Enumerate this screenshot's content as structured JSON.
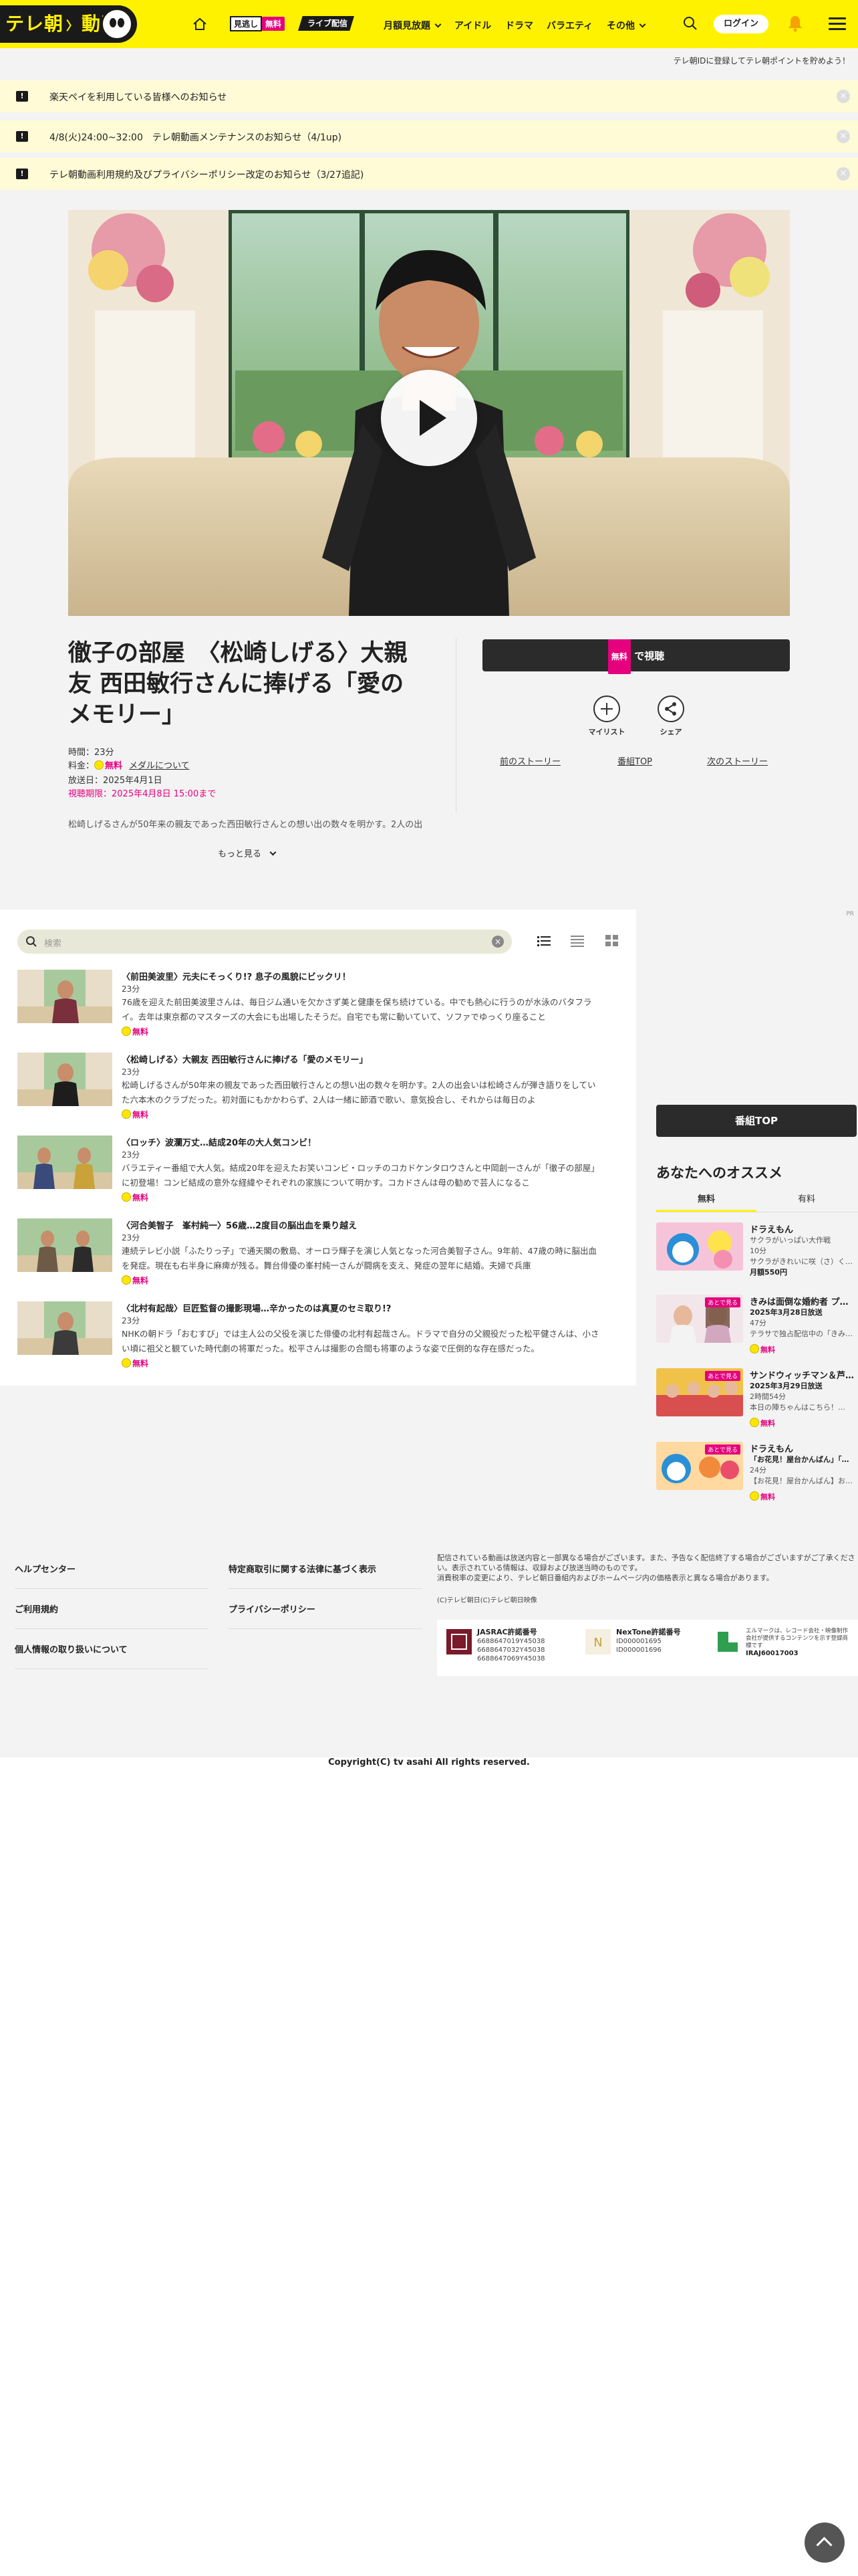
{
  "header": {
    "logo_text": "テレ朝",
    "logo_text2": "動画",
    "mito_label": "見逃し",
    "free_label": "無料",
    "live_label": "ライブ配信",
    "menu": [
      "月額見放題",
      "アイドル",
      "ドラマ",
      "バラエティ",
      "その他"
    ],
    "login_label": "ログイン"
  },
  "sub_banner": "テレ朝IDに登録してテレ朝ポイントを貯めよう！",
  "notices": [
    "楽天ペイを利用している皆様へのお知らせ",
    "4/8(火)24:00~32:00　テレ朝動画メンテナンスのお知らせ（4/1up)",
    "テレ朝動画利用規約及びプライバシーポリシー改定のお知らせ（3/27追記)"
  ],
  "episode": {
    "title": "徹子の部屋　〈松崎しげる〉大親友 西田敏行さんに捧げる「愛のメモリー」",
    "duration": "時間：23分",
    "price_prefix": "料金：",
    "price_free": "無料",
    "medal_link": "メダルについて",
    "broadcast_date": "放送日：2025年4月1日",
    "deadline": "視聴期限：2025年4月8日 15:00まで",
    "description": "松崎しげるさんが50年来の親友であった西田敏行さんとの想い出の数々を明かす。2人の出",
    "more_label": "もっと見る",
    "watch_free": "無料",
    "watch_label": "で視聴",
    "mylist_label": "マイリスト",
    "share_label": "シェア",
    "prev_story": "前のストーリー",
    "program_top": "番組TOP",
    "next_story": "次のストーリー"
  },
  "list": {
    "search_placeholder": "検索",
    "rows": [
      {
        "title": "〈前田美波里〉元夫にそっくり!? 息子の風貌にビックリ！",
        "duration": "23分",
        "desc": "76歳を迎えた前田美波里さんは、毎日ジム通いを欠かさず美と健康を保ち続けている。中でも熱心に行うのが水泳のバタフライ。去年は東京都のマスターズの大会にも出場したそうだ。自宅でも常に動いていて、ソファでゆっくり座ること",
        "badge": "無料"
      },
      {
        "title": "〈松崎しげる〉大親友 西田敏行さんに捧げる「愛のメモリー」",
        "duration": "23分",
        "desc": "松崎しげるさんが50年来の親友であった西田敏行さんとの想い出の数々を明かす。2人の出会いは松崎さんが弾き語りをしていた六本木のクラブだった。初対面にもかかわらず、2人は一緒に節酒で歌い、意気投合し、それからは毎日のよ",
        "badge": "無料"
      },
      {
        "title": "〈ロッチ〉波瀾万丈…結成20年の大人気コンビ！",
        "duration": "23分",
        "desc": "バラエティー番組で大人気。結成20年を迎えたお笑いコンビ・ロッチのコカドケンタロウさんと中岡創一さんが「徹子の部屋」に初登場！コンビ結成の意外な経緯やそれぞれの家族について明かす。コカドさんは母の勧めで芸人になるこ",
        "badge": "無料"
      },
      {
        "title": "〈河合美智子　峯村純一〉56歳…2度目の脳出血を乗り越え",
        "duration": "23分",
        "desc": "連続テレビ小説「ふたりっ子」で通天閣の敷島、オーロラ輝子を演じ人気となった河合美智子さん。9年前、47歳の時に脳出血を発症。現在も右半身に麻痺が残る。舞台俳優の峯村純一さんが闘病を支え、発症の翌年に結婚。夫婦で兵庫",
        "badge": "無料"
      },
      {
        "title": "〈北村有起哉〉巨匠監督の撮影現場…辛かったのは真夏のセミ取り!?",
        "duration": "23分",
        "desc": "NHKの朝ドラ「おむすび」では主人公の父役を演じた俳優の北村有起哉さん。ドラマで自分の父親役だった松平健さんは、小さい頃に祖父と観ていた時代劇の将軍だった。松平さんは撮影の合間も将軍のような姿で圧倒的な存在感だった。",
        "badge": "無料"
      }
    ]
  },
  "sidebar": {
    "pr_mark": "PR",
    "program_top": "番組TOP",
    "rec_title": "あなたへのオススメ",
    "tabs": [
      "無料",
      "有料"
    ],
    "items": [
      {
        "title": "ドラえもん",
        "line1": "サクラがいっぱい大作戦",
        "line2": "10分",
        "line3": "サクラがきれいに咲（さ）く…",
        "line4": "月額550円",
        "badge": "",
        "tag": ""
      },
      {
        "title": "きみは面倒な婚約者 プ…",
        "line1": "2025年3月28日放送",
        "line2": "47分",
        "line3": "テラサで独占配信中の「きみ…",
        "line4": "",
        "badge": "無料",
        "tag": "あとで見る"
      },
      {
        "title": "サンドウィッチマン＆芦…",
        "line1": "2025年3月29日放送",
        "line2": "2時間54分",
        "line3": "本日の陣ちゃんはこちら！…",
        "line4": "",
        "badge": "無料",
        "tag": "あとで見る"
      },
      {
        "title": "ドラえもん",
        "line1": "「お花見！屋台かんばん」「…",
        "line2": "24分",
        "line3": "【お花見！屋台かんばん】お…",
        "line4": "",
        "badge": "無料",
        "tag": "あとで見る"
      }
    ]
  },
  "footer": {
    "links_left": [
      "ヘルプセンター",
      "ご利用規約",
      "個人情報の取り扱いについて"
    ],
    "links_right": [
      "特定商取引に関する法律に基づく表示",
      "プライバシーポリシー"
    ],
    "note1": "配信されている動画は放送内容と一部異なる場合がございます。また、予告なく配信終了する場合がございますがご了承ください。表示されている情報は、収録および放送当時のものです。",
    "note2": "消費税率の変更により、テレビ朝日番組内およびホームページ内の価格表示と異なる場合があります。",
    "note3": "(C)テレビ朝日(C)テレビ朝日映像",
    "licenses": [
      {
        "name": "JASRAC許諾番号",
        "lines": [
          "6688647019Y45038",
          "6688647032Y45038",
          "6688647069Y45038"
        ]
      },
      {
        "name": "NexTone許諾番号",
        "lines": [
          "ID000001695",
          "ID000001696"
        ]
      },
      {
        "name": "エルマーク",
        "lines": [
          "エルマークは、レコード会社・映像制作会社が提供するコンテンツを示す登録商標です",
          "IRAJ60017003"
        ]
      }
    ],
    "copyright": "Copyright(C) tv asahi All rights reserved."
  }
}
